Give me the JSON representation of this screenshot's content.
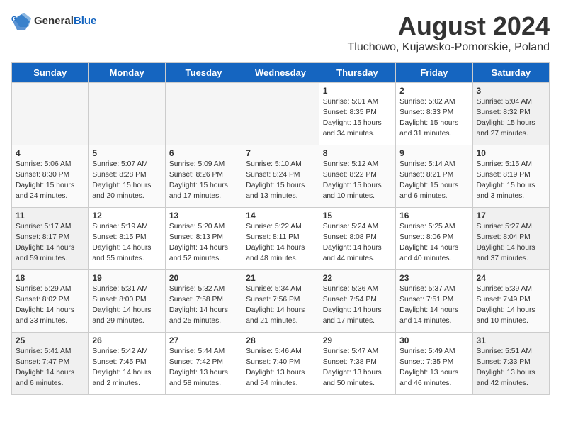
{
  "logo": {
    "general": "General",
    "blue": "Blue"
  },
  "title": "August 2024",
  "subtitle": "Tluchowo, Kujawsko-Pomorskie, Poland",
  "headers": [
    "Sunday",
    "Monday",
    "Tuesday",
    "Wednesday",
    "Thursday",
    "Friday",
    "Saturday"
  ],
  "weeks": [
    [
      {
        "day": "",
        "info": ""
      },
      {
        "day": "",
        "info": ""
      },
      {
        "day": "",
        "info": ""
      },
      {
        "day": "",
        "info": ""
      },
      {
        "day": "1",
        "info": "Sunrise: 5:01 AM\nSunset: 8:35 PM\nDaylight: 15 hours\nand 34 minutes."
      },
      {
        "day": "2",
        "info": "Sunrise: 5:02 AM\nSunset: 8:33 PM\nDaylight: 15 hours\nand 31 minutes."
      },
      {
        "day": "3",
        "info": "Sunrise: 5:04 AM\nSunset: 8:32 PM\nDaylight: 15 hours\nand 27 minutes."
      }
    ],
    [
      {
        "day": "4",
        "info": "Sunrise: 5:06 AM\nSunset: 8:30 PM\nDaylight: 15 hours\nand 24 minutes."
      },
      {
        "day": "5",
        "info": "Sunrise: 5:07 AM\nSunset: 8:28 PM\nDaylight: 15 hours\nand 20 minutes."
      },
      {
        "day": "6",
        "info": "Sunrise: 5:09 AM\nSunset: 8:26 PM\nDaylight: 15 hours\nand 17 minutes."
      },
      {
        "day": "7",
        "info": "Sunrise: 5:10 AM\nSunset: 8:24 PM\nDaylight: 15 hours\nand 13 minutes."
      },
      {
        "day": "8",
        "info": "Sunrise: 5:12 AM\nSunset: 8:22 PM\nDaylight: 15 hours\nand 10 minutes."
      },
      {
        "day": "9",
        "info": "Sunrise: 5:14 AM\nSunset: 8:21 PM\nDaylight: 15 hours\nand 6 minutes."
      },
      {
        "day": "10",
        "info": "Sunrise: 5:15 AM\nSunset: 8:19 PM\nDaylight: 15 hours\nand 3 minutes."
      }
    ],
    [
      {
        "day": "11",
        "info": "Sunrise: 5:17 AM\nSunset: 8:17 PM\nDaylight: 14 hours\nand 59 minutes."
      },
      {
        "day": "12",
        "info": "Sunrise: 5:19 AM\nSunset: 8:15 PM\nDaylight: 14 hours\nand 55 minutes."
      },
      {
        "day": "13",
        "info": "Sunrise: 5:20 AM\nSunset: 8:13 PM\nDaylight: 14 hours\nand 52 minutes."
      },
      {
        "day": "14",
        "info": "Sunrise: 5:22 AM\nSunset: 8:11 PM\nDaylight: 14 hours\nand 48 minutes."
      },
      {
        "day": "15",
        "info": "Sunrise: 5:24 AM\nSunset: 8:08 PM\nDaylight: 14 hours\nand 44 minutes."
      },
      {
        "day": "16",
        "info": "Sunrise: 5:25 AM\nSunset: 8:06 PM\nDaylight: 14 hours\nand 40 minutes."
      },
      {
        "day": "17",
        "info": "Sunrise: 5:27 AM\nSunset: 8:04 PM\nDaylight: 14 hours\nand 37 minutes."
      }
    ],
    [
      {
        "day": "18",
        "info": "Sunrise: 5:29 AM\nSunset: 8:02 PM\nDaylight: 14 hours\nand 33 minutes."
      },
      {
        "day": "19",
        "info": "Sunrise: 5:31 AM\nSunset: 8:00 PM\nDaylight: 14 hours\nand 29 minutes."
      },
      {
        "day": "20",
        "info": "Sunrise: 5:32 AM\nSunset: 7:58 PM\nDaylight: 14 hours\nand 25 minutes."
      },
      {
        "day": "21",
        "info": "Sunrise: 5:34 AM\nSunset: 7:56 PM\nDaylight: 14 hours\nand 21 minutes."
      },
      {
        "day": "22",
        "info": "Sunrise: 5:36 AM\nSunset: 7:54 PM\nDaylight: 14 hours\nand 17 minutes."
      },
      {
        "day": "23",
        "info": "Sunrise: 5:37 AM\nSunset: 7:51 PM\nDaylight: 14 hours\nand 14 minutes."
      },
      {
        "day": "24",
        "info": "Sunrise: 5:39 AM\nSunset: 7:49 PM\nDaylight: 14 hours\nand 10 minutes."
      }
    ],
    [
      {
        "day": "25",
        "info": "Sunrise: 5:41 AM\nSunset: 7:47 PM\nDaylight: 14 hours\nand 6 minutes."
      },
      {
        "day": "26",
        "info": "Sunrise: 5:42 AM\nSunset: 7:45 PM\nDaylight: 14 hours\nand 2 minutes."
      },
      {
        "day": "27",
        "info": "Sunrise: 5:44 AM\nSunset: 7:42 PM\nDaylight: 13 hours\nand 58 minutes."
      },
      {
        "day": "28",
        "info": "Sunrise: 5:46 AM\nSunset: 7:40 PM\nDaylight: 13 hours\nand 54 minutes."
      },
      {
        "day": "29",
        "info": "Sunrise: 5:47 AM\nSunset: 7:38 PM\nDaylight: 13 hours\nand 50 minutes."
      },
      {
        "day": "30",
        "info": "Sunrise: 5:49 AM\nSunset: 7:35 PM\nDaylight: 13 hours\nand 46 minutes."
      },
      {
        "day": "31",
        "info": "Sunrise: 5:51 AM\nSunset: 7:33 PM\nDaylight: 13 hours\nand 42 minutes."
      }
    ]
  ]
}
